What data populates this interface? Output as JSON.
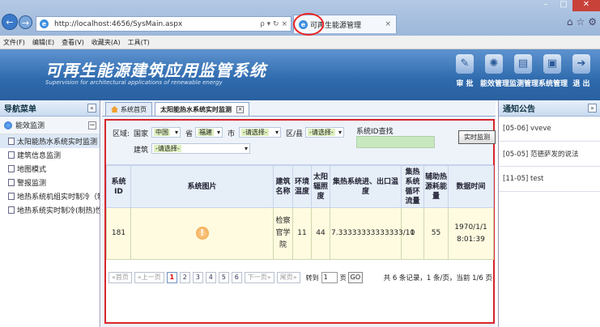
{
  "browser": {
    "url": "http://localhost:4656/SysMain.aspx",
    "addr_tools": "ρ ▾ ↻ ×",
    "tab_title": "可再生能源管理",
    "back_icon": "←",
    "forward_icon": "→",
    "tab_close": "×",
    "right_tools": [
      "⌂",
      "☆",
      "⚙"
    ]
  },
  "menubar": [
    "文件(F)",
    "编辑(E)",
    "查看(V)",
    "收藏夹(A)",
    "工具(T)"
  ],
  "banner": {
    "title": "可再生能源建筑应用监管系统",
    "subtitle": "Supervision for architectural applications of renewable energy",
    "nav": [
      {
        "label": "审 批",
        "icon": "approve-icon",
        "glyph": "✎"
      },
      {
        "label": "能效管理",
        "icon": "bulb-icon",
        "glyph": "✺"
      },
      {
        "label": "监测管理",
        "icon": "chart-icon",
        "glyph": "▤"
      },
      {
        "label": "系统管理",
        "icon": "monitor-icon",
        "glyph": "▣"
      },
      {
        "label": "退 出",
        "icon": "exit-icon",
        "glyph": "➔"
      }
    ]
  },
  "sidebar": {
    "title": "导航菜单",
    "collapse": "«",
    "group": "能效监测",
    "group_toggle": "−",
    "items": [
      "太阳能热水系统实时监测",
      "建筑信息监测",
      "地图模式",
      "警报监测",
      "地热系统机组实时制冷（制",
      "地热系统实时制冷(制热)性能"
    ]
  },
  "content": {
    "tabs": [
      {
        "label": "系统首页"
      },
      {
        "label": "太阳能热水系统实时监测",
        "close": "×"
      }
    ],
    "filter": {
      "region_label": "区域:",
      "country_label": "国家",
      "country": "中国",
      "province_label": "省",
      "province": "福建",
      "city_label": "市",
      "city": "-请选择-",
      "district_label": "区/县",
      "district": "-请选择-",
      "building_label": "建筑",
      "building": "-请选择-",
      "sysid_label": "系统ID查找",
      "realtime_btn": "实时监测"
    },
    "table": {
      "headers": [
        "系统ID",
        "系统图片",
        "建筑名称",
        "环境温度",
        "太阳辐照度",
        "集热系统进、出口温度",
        "集热系统循环流量",
        "辅助热源耗能量",
        "数据时间"
      ],
      "rows": [
        {
          "id": "181",
          "image_icon": "!",
          "building": "检察官学院",
          "ambient_temp": "11",
          "irradiance": "44",
          "inout_temp": "7.33333333333333/11",
          "flow": "0",
          "aux_energy": "55",
          "time": "1970/1/1 8:01:39"
        }
      ]
    },
    "pager": {
      "first": "«首页",
      "prev": "«上一页",
      "pages": [
        "1",
        "2",
        "3",
        "4",
        "5",
        "6"
      ],
      "current": "1",
      "next": "下一页»",
      "last": "尾页»",
      "goto_label": "转到",
      "goto_value": "1",
      "page_unit": "页",
      "go": "GO",
      "info": "共 6 条记录，1 条/页，当前 1/6 页"
    }
  },
  "notices": {
    "title": "通知公告",
    "expand": "»",
    "items": [
      "[05-06] vveve",
      "[05-05] 范德萨发的说法",
      "[11-05] test"
    ]
  }
}
